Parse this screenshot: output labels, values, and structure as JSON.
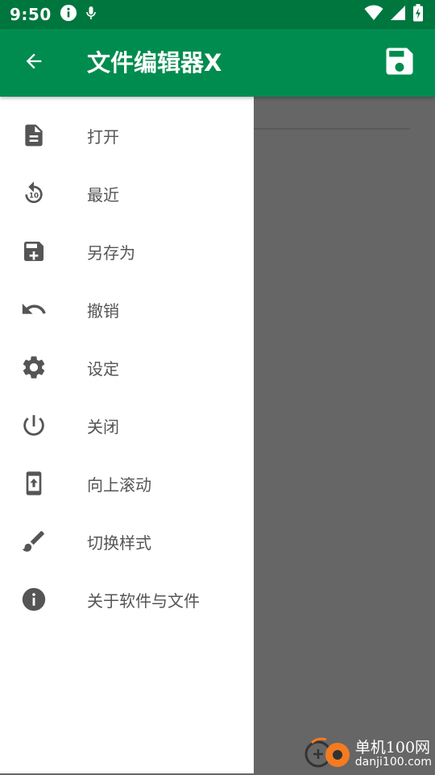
{
  "status_bar": {
    "time": "9:50",
    "icons": [
      "info-icon",
      "mic-icon",
      "wifi-icon",
      "signal-icon",
      "battery-charging-icon"
    ]
  },
  "app_bar": {
    "title": "文件编辑器X",
    "back_icon": "arrow-back-icon",
    "save_icon": "save-icon"
  },
  "drawer": {
    "items": [
      {
        "label": "打开",
        "icon": "file-icon"
      },
      {
        "label": "最近",
        "icon": "replay-10-icon"
      },
      {
        "label": "另存为",
        "icon": "save-add-icon"
      },
      {
        "label": "撤销",
        "icon": "undo-icon"
      },
      {
        "label": "设定",
        "icon": "gear-icon"
      },
      {
        "label": "关闭",
        "icon": "power-icon"
      },
      {
        "label": "向上滚动",
        "icon": "phone-upload-icon"
      },
      {
        "label": "切换样式",
        "icon": "brush-icon"
      },
      {
        "label": "关于软件与文件",
        "icon": "info-circle-icon"
      }
    ]
  },
  "watermark": {
    "line1": "单机100网",
    "line2": "danji100.com"
  },
  "colors": {
    "status_bar": "#00763f",
    "app_bar": "#008c4f",
    "drawer_bg": "#ffffff",
    "scrim": "#666666",
    "icon": "#555555",
    "accent_orange": "#f47b20"
  }
}
